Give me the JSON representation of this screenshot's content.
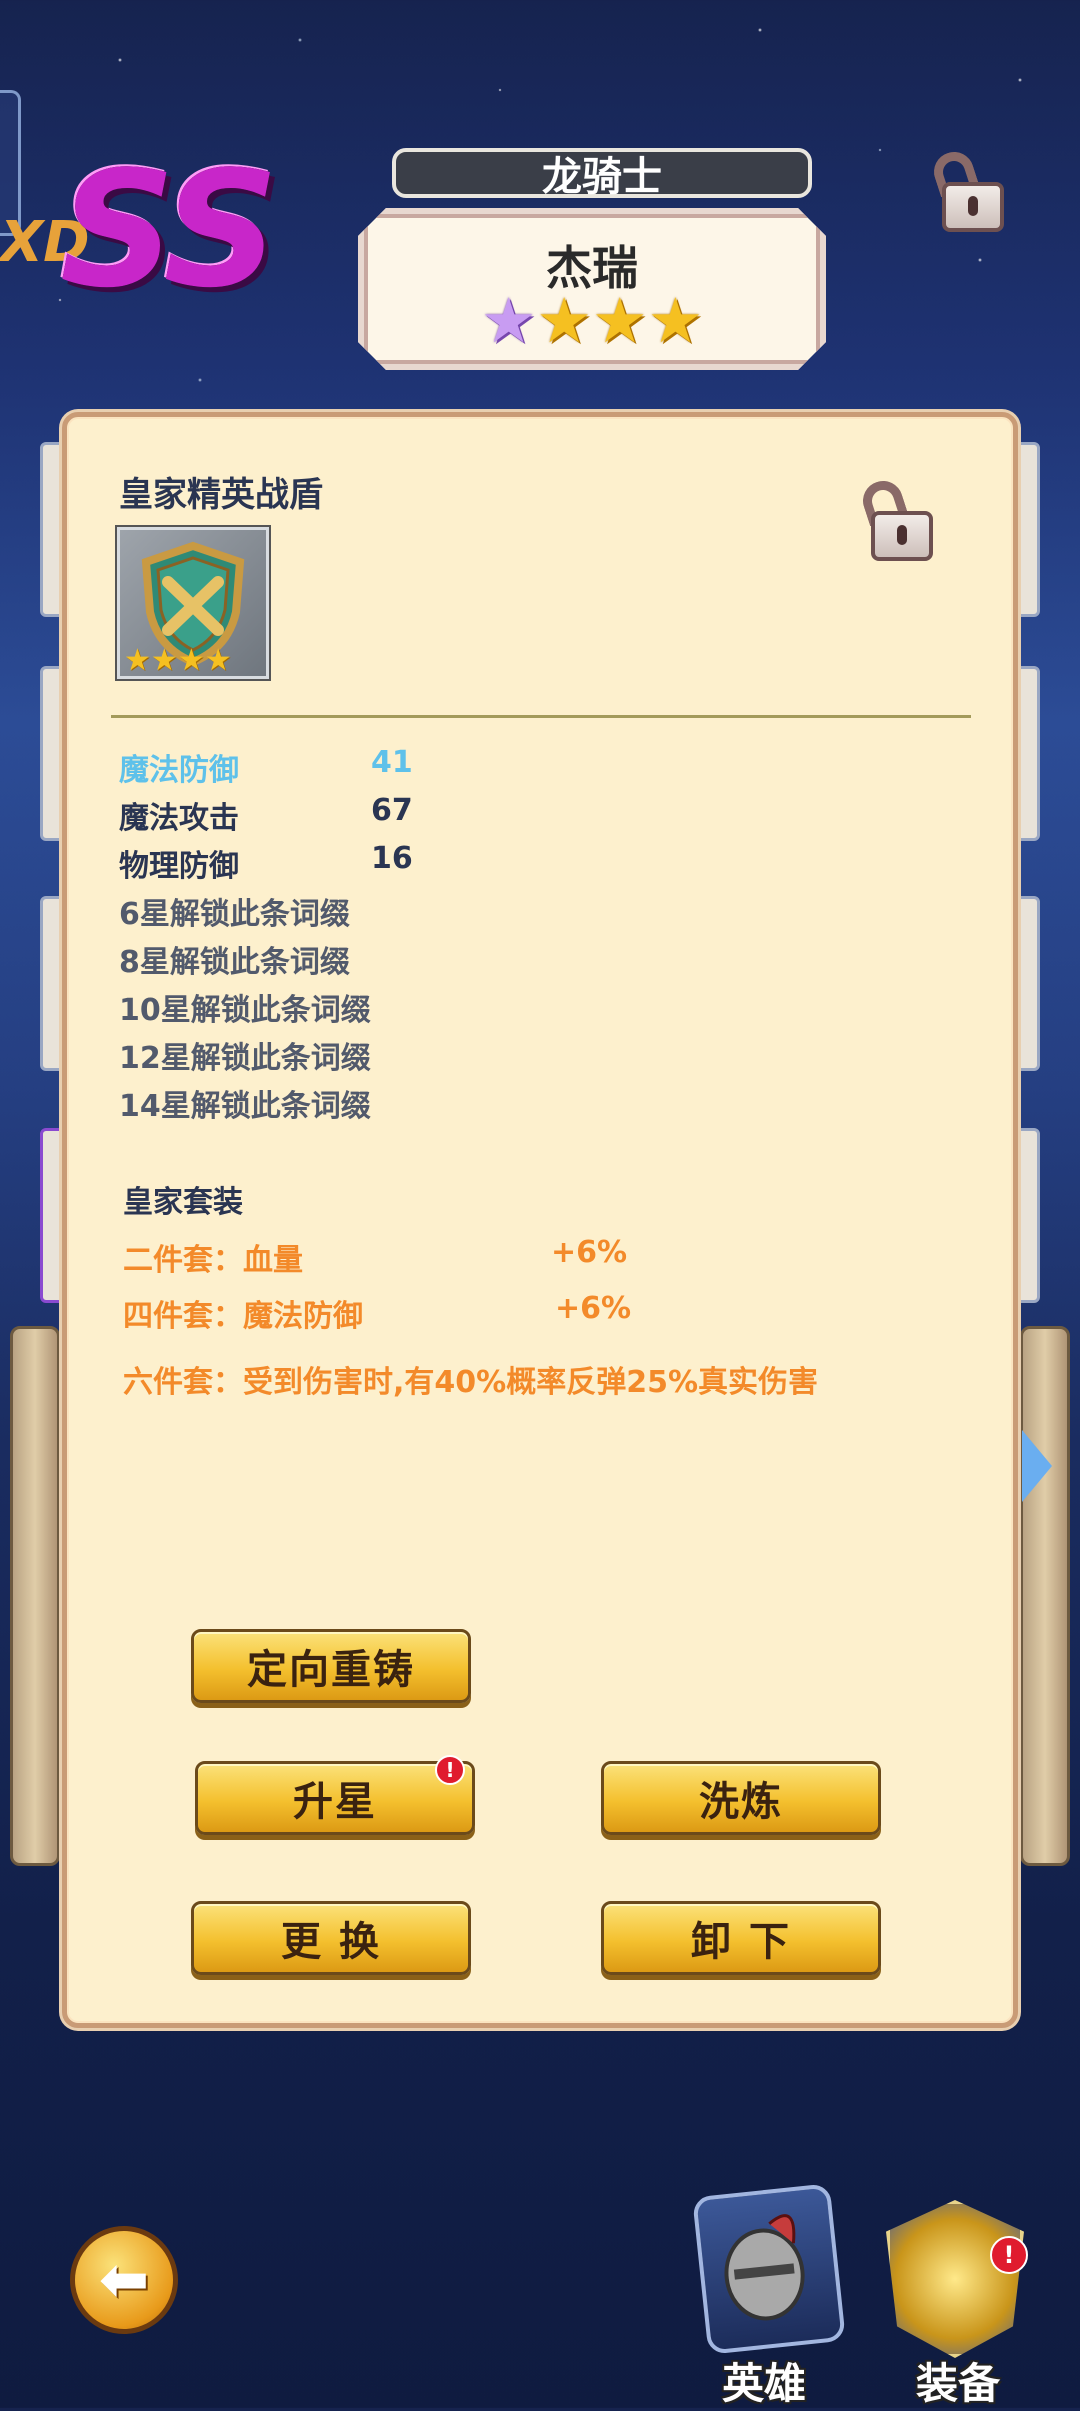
{
  "grade": {
    "prefix": "XD",
    "label": "SS"
  },
  "hero": {
    "class_title": "龙骑士",
    "name": "杰瑞",
    "stars": 4
  },
  "item": {
    "name": "皇家精英战盾",
    "icon": "shield-icon",
    "stars": 4,
    "stats": [
      {
        "label": "魔法防御",
        "value": "41",
        "highlight": true
      },
      {
        "label": "魔法攻击",
        "value": "67",
        "highlight": false
      },
      {
        "label": "物理防御",
        "value": "16",
        "highlight": false
      }
    ],
    "locked_affixes": [
      "6星解锁此条词缀",
      "8星解锁此条词缀",
      "10星解锁此条词缀",
      "12星解锁此条词缀",
      "14星解锁此条词缀"
    ]
  },
  "set_bonus": {
    "title": "皇家套装",
    "entries": [
      {
        "label": "二件套：血量",
        "value": "+6%"
      },
      {
        "label": "四件套：魔法防御",
        "value": "+6%"
      },
      {
        "label": "六件套：受到伤害时,有40%概率反弹25%真实伤害",
        "value": ""
      }
    ]
  },
  "buttons": {
    "reforge": "定向重铸",
    "upgrade_star": "升星",
    "refine": "洗炼",
    "replace": "更 换",
    "unequip": "卸 下"
  },
  "badges": {
    "upgrade_star": "!",
    "equipment": "!"
  },
  "nav": {
    "back": "back-arrow-icon",
    "hero": "英雄",
    "equipment": "装备"
  },
  "colors": {
    "accent_gold": "#f4c02e",
    "highlight_stat": "#5ec1ea",
    "set_text": "#f38a2a",
    "grade_magenta": "#c826c9"
  }
}
